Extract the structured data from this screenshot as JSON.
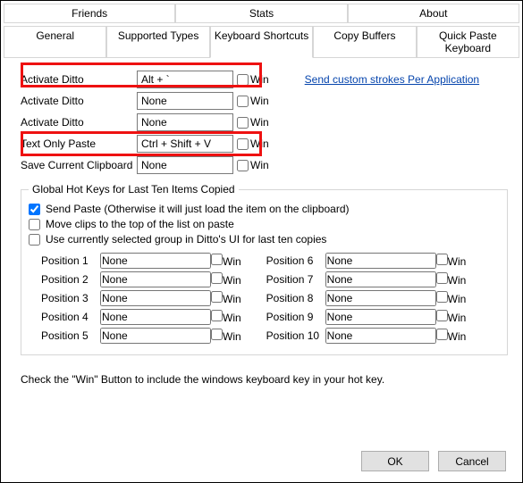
{
  "tabsTop": [
    "Friends",
    "Stats",
    "About"
  ],
  "tabsBottom": [
    "General",
    "Supported Types",
    "Keyboard Shortcuts",
    "Copy Buffers",
    "Quick Paste Keyboard"
  ],
  "activeTab": "Keyboard Shortcuts",
  "rows": [
    {
      "label": "Activate Ditto",
      "value": "Alt + `"
    },
    {
      "label": "Activate Ditto",
      "value": "None"
    },
    {
      "label": "Activate Ditto",
      "value": "None"
    },
    {
      "label": "Text Only Paste",
      "value": "Ctrl + Shift + V"
    },
    {
      "label": "Save Current Clipboard",
      "value": "None"
    }
  ],
  "winLabel": "Win",
  "link": "Send custom strokes Per Application",
  "group": {
    "legend": "Global Hot Keys for Last Ten Items Copied",
    "opts": [
      {
        "label": "Send Paste (Otherwise it will just load the item on the clipboard)",
        "checked": true
      },
      {
        "label": "Move clips to the top of the list on paste",
        "checked": false
      },
      {
        "label": "Use currently selected group in Ditto's UI for last ten copies",
        "checked": false
      }
    ],
    "positionsLeft": [
      {
        "label": "Position 1",
        "value": "None"
      },
      {
        "label": "Position 2",
        "value": "None"
      },
      {
        "label": "Position 3",
        "value": "None"
      },
      {
        "label": "Position 4",
        "value": "None"
      },
      {
        "label": "Position 5",
        "value": "None"
      }
    ],
    "positionsRight": [
      {
        "label": "Position 6",
        "value": "None"
      },
      {
        "label": "Position 7",
        "value": "None"
      },
      {
        "label": "Position 8",
        "value": "None"
      },
      {
        "label": "Position 9",
        "value": "None"
      },
      {
        "label": "Position 10",
        "value": "None"
      }
    ]
  },
  "note": "Check the \"Win\" Button to include the windows keyboard key in your hot key.",
  "buttons": {
    "ok": "OK",
    "cancel": "Cancel"
  }
}
